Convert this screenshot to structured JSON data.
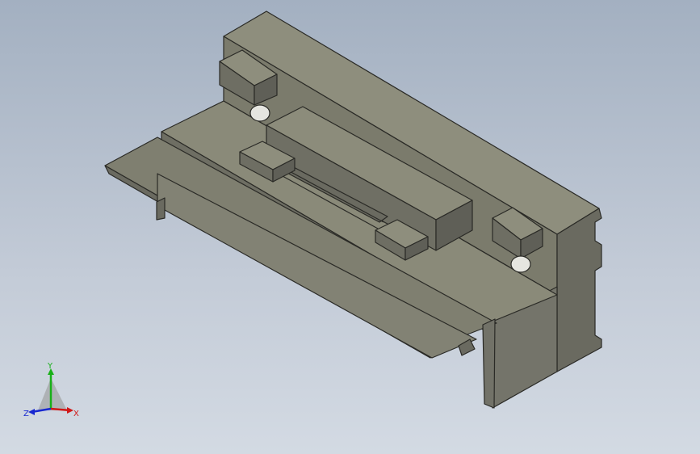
{
  "viewport": {
    "background_top": "#a3b0c1",
    "background_bottom": "#d3dae3"
  },
  "model": {
    "face_light": "#8b8b7a",
    "face_mid": "#76766a",
    "face_dark": "#5f5f57",
    "edge": "#2a2a26"
  },
  "triad": {
    "x_label": "X",
    "y_label": "Y",
    "z_label": "Z",
    "x_color": "#d01818",
    "y_color": "#18b018",
    "z_color": "#1828d0"
  }
}
